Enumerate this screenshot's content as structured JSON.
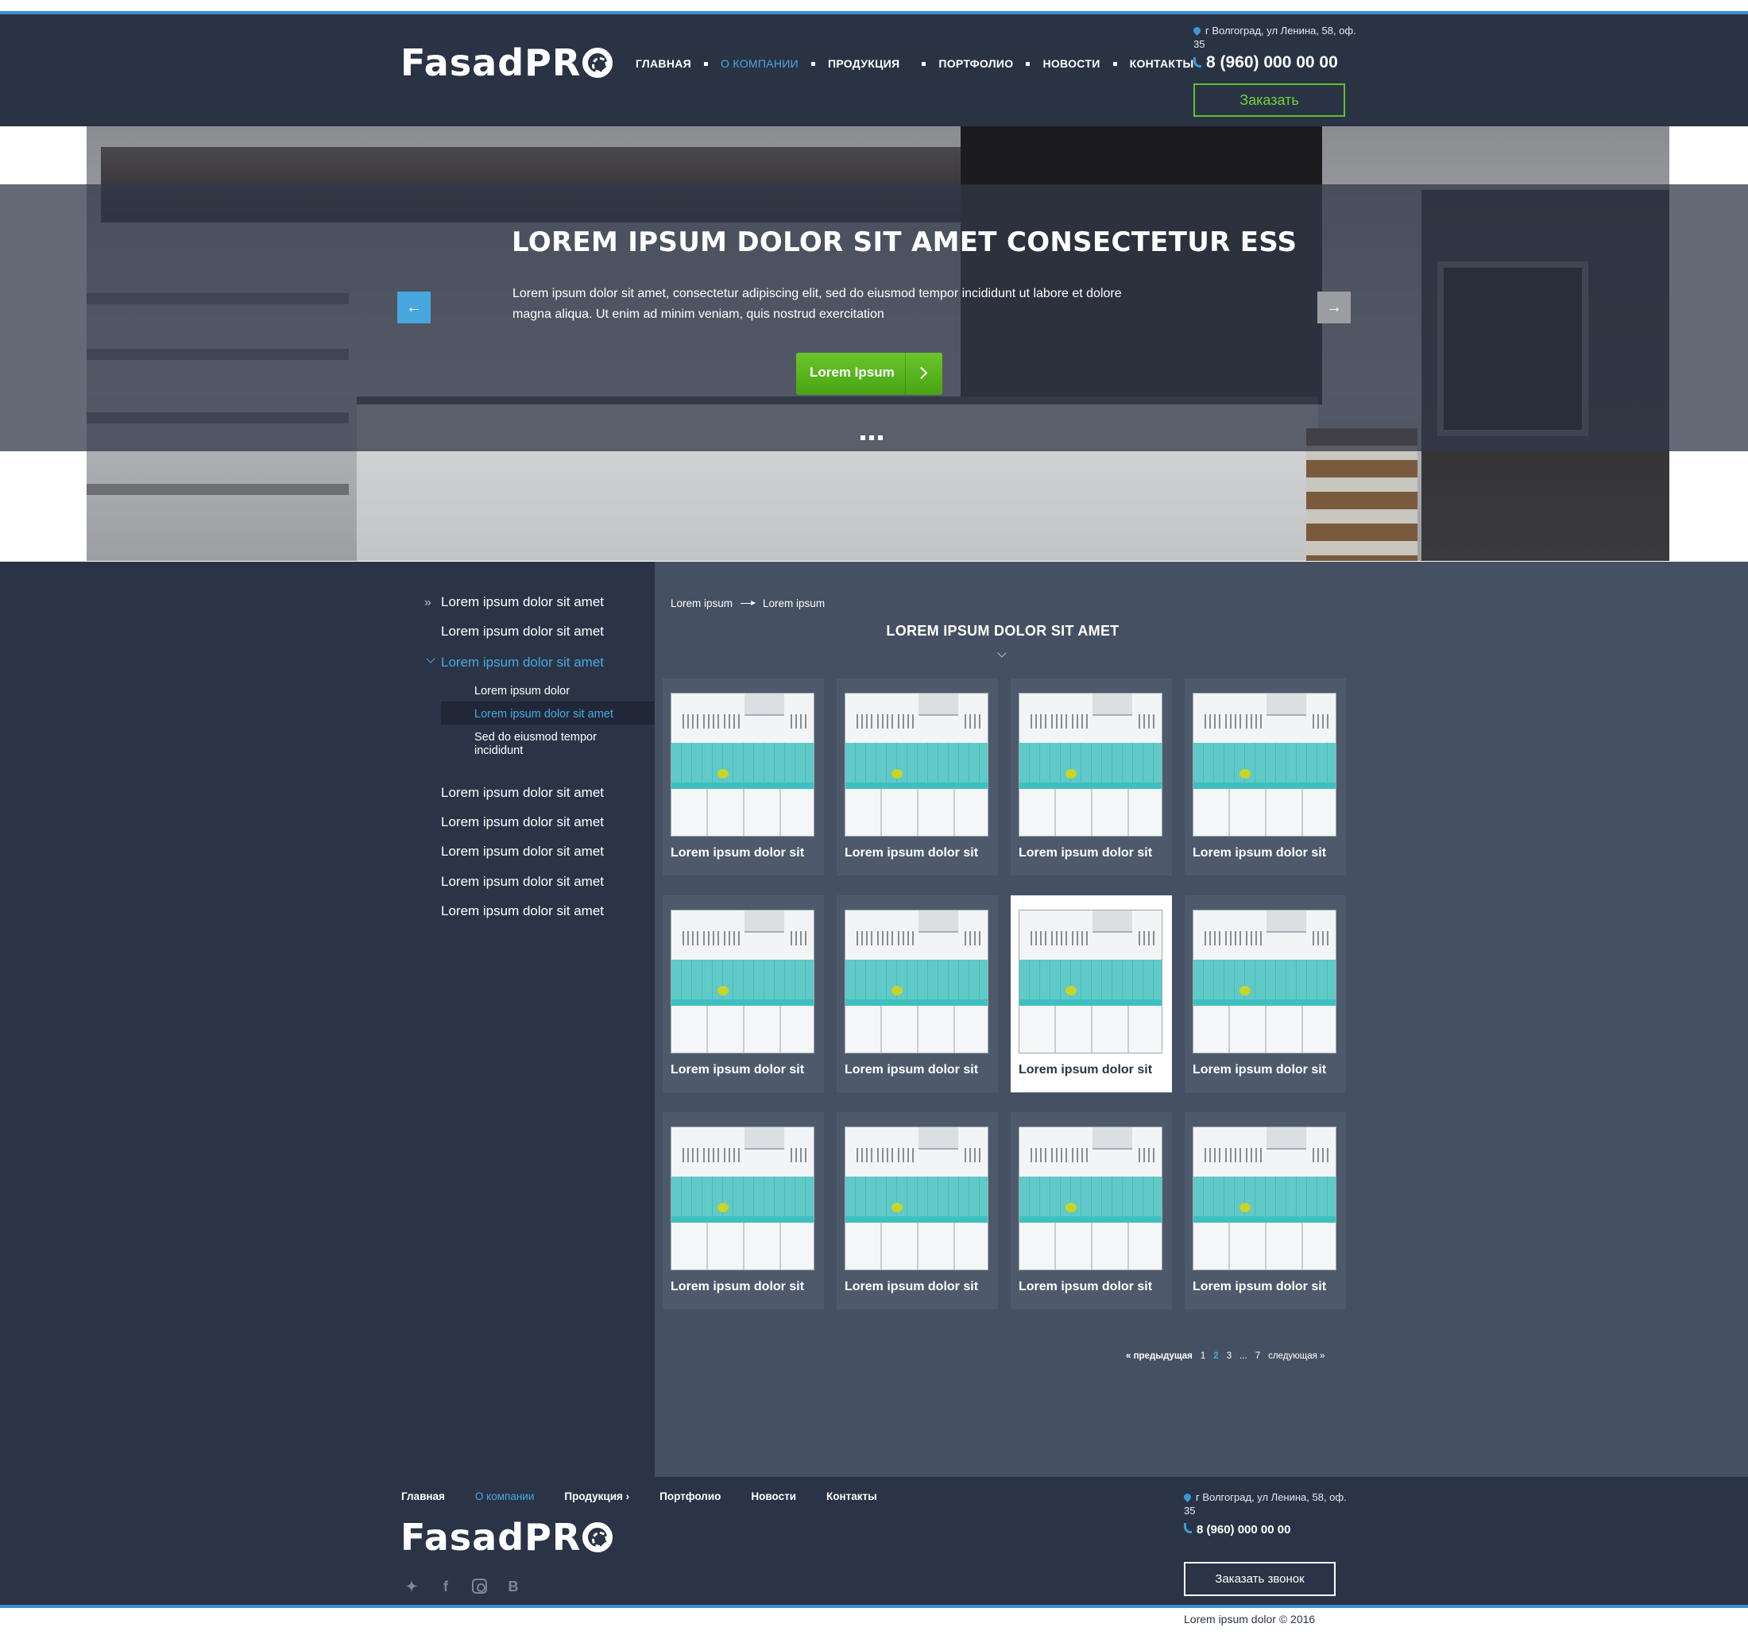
{
  "header": {
    "logo": "FasadPRO",
    "nav": [
      {
        "label": "ГЛАВНАЯ",
        "active": false
      },
      {
        "label": "О КОМПАНИИ",
        "active": true
      },
      {
        "label": "ПРОДУКЦИЯ",
        "active": false
      },
      {
        "label": "ПОРТФОЛИО",
        "active": false
      },
      {
        "label": "НОВОСТИ",
        "active": false
      },
      {
        "label": "КОНТАКТЫ",
        "active": false
      }
    ],
    "address": "г Волгоград, ул Ленина, 58, оф. 35",
    "phone": "8 (960) 000 00 00",
    "order_button": "Заказать"
  },
  "hero": {
    "title": "LOREM IPSUM DOLOR SIT AMET CONSECTETUR ESS",
    "text": "Lorem ipsum dolor sit amet, consectetur adipiscing elit, sed do eiusmod tempor incididunt ut labore et dolore magna aliqua. Ut enim ad minim veniam, quis nostrud exercitation",
    "button": "Lorem Ipsum",
    "slides": 3
  },
  "sidebar": {
    "items": [
      "Lorem ipsum dolor sit amet",
      "Lorem ipsum dolor sit amet",
      "Lorem ipsum dolor sit amet",
      "Lorem ipsum dolor sit amet",
      "Lorem ipsum dolor sit amet",
      "Lorem ipsum dolor sit amet",
      "Lorem ipsum dolor sit amet",
      "Lorem ipsum dolor sit amet"
    ],
    "subitems": [
      "Lorem ipsum dolor",
      "Lorem ipsum dolor sit amet",
      "Sed do eiusmod tempor incididunt"
    ]
  },
  "breadcrumb": [
    "Lorem ipsum",
    "Lorem ipsum"
  ],
  "section_title": "LOREM IPSUM DOLOR SIT AMET",
  "products": [
    "Lorem ipsum dolor sit",
    "Lorem ipsum dolor sit",
    "Lorem ipsum dolor sit",
    "Lorem ipsum dolor sit",
    "Lorem ipsum dolor sit",
    "Lorem ipsum dolor sit",
    "Lorem ipsum dolor sit",
    "Lorem ipsum dolor sit",
    "Lorem ipsum dolor sit",
    "Lorem ipsum dolor sit",
    "Lorem ipsum dolor sit",
    "Lorem ipsum dolor sit"
  ],
  "pager": {
    "prev": "« предыдущая",
    "pages": [
      "1",
      "2",
      "3",
      "...",
      "7"
    ],
    "current": "2",
    "next": "следующая »"
  },
  "footer": {
    "nav": [
      "Главная",
      "О компании",
      "Продукция  ›",
      "Портфолио",
      "Новости",
      "Контакты"
    ],
    "logo": "FasadPRO",
    "address": "г Волгоград, ул Ленина, 58, оф. 35",
    "phone": "8 (960) 000 00 00",
    "call_button": "Заказать звонок",
    "copyright": "Lorem ipsum dolor © 2016",
    "social": [
      "twitter-icon",
      "facebook-icon",
      "instagram-icon",
      "vk-icon"
    ]
  },
  "colors": {
    "navy": "#2a3446",
    "panel": "#465063",
    "accent_blue": "#4aa8e0",
    "accent_green": "#5dc230"
  }
}
